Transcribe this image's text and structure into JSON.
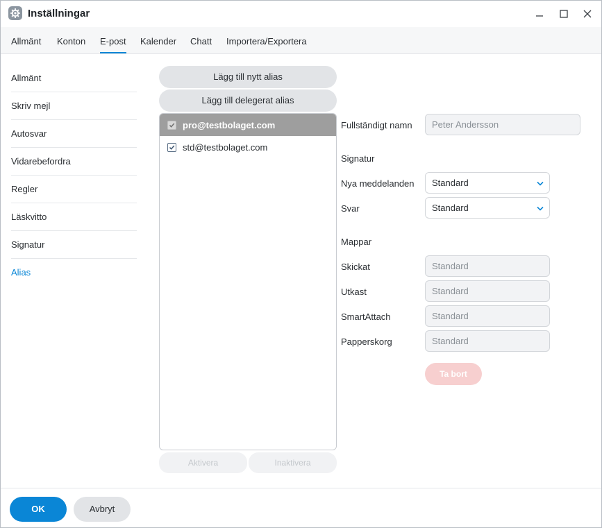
{
  "window": {
    "title": "Inställningar"
  },
  "tabs": [
    {
      "label": "Allmänt"
    },
    {
      "label": "Konton"
    },
    {
      "label": "E-post"
    },
    {
      "label": "Kalender"
    },
    {
      "label": "Chatt"
    },
    {
      "label": "Importera/Exportera"
    }
  ],
  "active_tab": "E-post",
  "sidebar": {
    "items": [
      {
        "label": "Allmänt"
      },
      {
        "label": "Skriv mejl"
      },
      {
        "label": "Autosvar"
      },
      {
        "label": "Vidarebefordra"
      },
      {
        "label": "Regler"
      },
      {
        "label": "Läskvitto"
      },
      {
        "label": "Signatur"
      },
      {
        "label": "Alias"
      }
    ],
    "active": "Alias"
  },
  "alias_panel": {
    "add_alias_label": "Lägg till nytt alias",
    "add_delegated_label": "Lägg till delegerat alias",
    "aliases": [
      {
        "email": "pro@testbolaget.com",
        "checked": true,
        "selected": true
      },
      {
        "email": "std@testbolaget.com",
        "checked": true,
        "selected": false
      }
    ],
    "activate_label": "Aktivera",
    "deactivate_label": "Inaktivera"
  },
  "details": {
    "full_name_label": "Fullständigt namn",
    "full_name_value": "Peter Andersson",
    "signature_heading": "Signatur",
    "new_messages_label": "Nya meddelanden",
    "new_messages_value": "Standard",
    "reply_label": "Svar",
    "reply_value": "Standard",
    "folders_heading": "Mappar",
    "sent_label": "Skickat",
    "sent_value": "Standard",
    "drafts_label": "Utkast",
    "drafts_value": "Standard",
    "smartattach_label": "SmartAttach",
    "smartattach_value": "Standard",
    "trash_label": "Papperskorg",
    "trash_value": "Standard",
    "remove_label": "Ta bort"
  },
  "footer": {
    "ok_label": "OK",
    "cancel_label": "Avbryt"
  },
  "colors": {
    "accent": "#0a86d6",
    "selected_row": "#9e9e9e",
    "danger_disabled": "#f7cfcf"
  },
  "icons": {
    "app": "settings-gear-icon",
    "minimize": "minimize-icon",
    "maximize": "maximize-icon",
    "close": "close-icon",
    "checkbox": "checkmark-icon",
    "dropdown": "chevron-down-icon"
  }
}
